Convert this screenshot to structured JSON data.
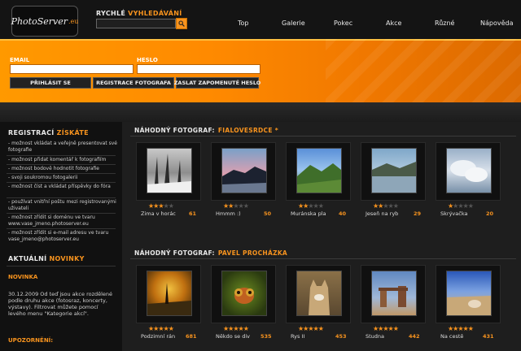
{
  "header": {
    "logo_main": "PhotoServer",
    "logo_accent": ".eu",
    "search_label_1": "RYCHLÉ",
    "search_label_2": "VYHLEDÁVÁNÍ",
    "search_value": "",
    "search_icon": "search-icon",
    "nav": [
      "Top",
      "Galerie",
      "Pokec",
      "Akce",
      "Různé",
      "Nápověda"
    ]
  },
  "login": {
    "email_label": "EMAIL",
    "password_label": "HESLO",
    "email_value": "",
    "password_value": "",
    "login_button": "PŘIHLÁSIT SE",
    "register_button": "REGISTRACE FOTOGRAFA",
    "forgot_button": "ZASLAT ZAPOMENUTÉ HESLO"
  },
  "sidebar": {
    "reg_heading": "REGISTRACÍ",
    "reg_heading_hl": "ZÍSKÁTE",
    "benefits": [
      "- možnost vkládat a veřejně presentovat své fotografie",
      "- možnost přidat komentář k fotografiím",
      "- možnost bodově hodnotit fotografie",
      "- svoji soukromou fotogalerii",
      "- možnost číst a vkládat příspěvky do fóra",
      "- používat vnitřní poštu mezi registrovanými uživateli",
      "- možnost zřídit si doménu ve tvaru www.vase_jmeno.photoserver.eu",
      "- možnost zřídit si e-mail adresu ve tvaru vase_jmeno@photoserver.eu"
    ],
    "news_heading": "AKTUÁLNÍ",
    "news_heading_hl": "NOVINKY",
    "news_title": "NOVINKA",
    "news_body": "30.12.2009 Od teď jsou akce rozdělené podle druhu akce (fotosraz, koncerty, výstavy). Filtrovat můžete pomocí levého menu \"Kategorie akcí\".",
    "notice_title": "UPOZORNĚNÍ:"
  },
  "sections": [
    {
      "label": "NÁHODNÝ FOTOGRAF:",
      "photographer": "FIALOVESRDCE *",
      "photos": [
        {
          "caption": "Zima v horác",
          "score": "61",
          "rating": 3
        },
        {
          "caption": "Hmmm :)",
          "score": "50",
          "rating": 2
        },
        {
          "caption": "Muránska pla",
          "score": "40",
          "rating": 2
        },
        {
          "caption": "Jeseň na ryb",
          "score": "29",
          "rating": 2
        },
        {
          "caption": "Skrývačka",
          "score": "20",
          "rating": 1
        }
      ]
    },
    {
      "label": "NÁHODNÝ FOTOGRAF:",
      "photographer": "PAVEL PROCHÁZKA",
      "photos": [
        {
          "caption": "Podzimní rán",
          "score": "681",
          "rating": 5
        },
        {
          "caption": "Někdo se div",
          "score": "535",
          "rating": 5
        },
        {
          "caption": "Rys II",
          "score": "453",
          "rating": 5
        },
        {
          "caption": "Studna",
          "score": "442",
          "rating": 5
        },
        {
          "caption": "Na cestě",
          "score": "431",
          "rating": 5
        }
      ]
    }
  ],
  "colors": {
    "accent": "#f7931e",
    "band": "#ff9900",
    "background": "#1b1b1b"
  }
}
